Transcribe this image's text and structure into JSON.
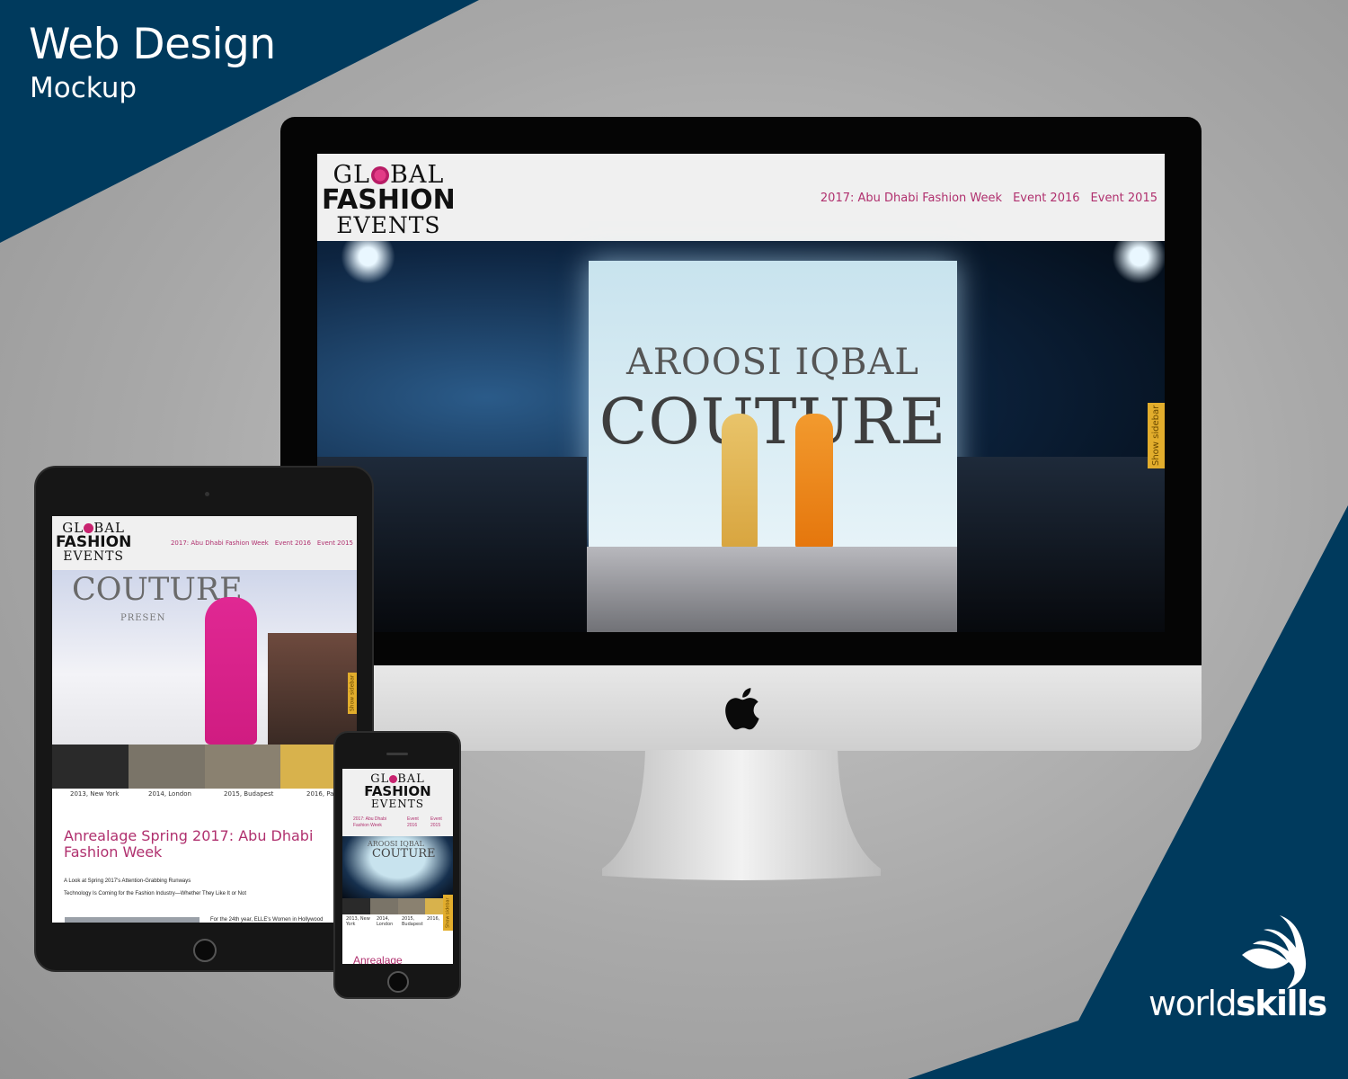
{
  "banner": {
    "title": "Web Design",
    "subtitle": "Mockup"
  },
  "site": {
    "logo": {
      "line1": "GL",
      "line1_end": "BAL",
      "line2": "FASHION",
      "line3": "EVENTS"
    },
    "nav": [
      "2017: Abu Dhabi Fashion Week",
      "Event 2016",
      "Event 2015"
    ],
    "sidebar_tab": "Show sidebar",
    "hero_text": {
      "brand": "AROOSI IQBAL",
      "line": "COUTURE"
    }
  },
  "tablet": {
    "hero_text": {
      "brand": "COUTURE",
      "presents": "PRESEN"
    },
    "thumb_captions": [
      "2013, New York",
      "2014, London",
      "2015, Budapest",
      "2016, Pari"
    ],
    "article_title": "Anrealage Spring 2017: Abu Dhabi Fashion Week",
    "article_lines": [
      "A Look at Spring 2017's Attention-Grabbing Runways",
      "Technology Is Coming for the Fashion Industry—Whether They Like It or Not"
    ],
    "footer_snippet": "For the 24th year, ELLE's Women in Hollywood"
  },
  "phone": {
    "nav": [
      [
        "2017: Abu Dhabi",
        "Fashion Week"
      ],
      [
        "Event",
        "2016"
      ],
      [
        "Event",
        "2015"
      ]
    ],
    "thumb_captions": [
      [
        "2013, New",
        "York"
      ],
      [
        "2014,",
        "London"
      ],
      [
        "2015,",
        "Budapest"
      ],
      [
        "2016,",
        ""
      ]
    ],
    "article_title_partial": "Anrealage"
  },
  "brand_mark": {
    "part1": "world",
    "part2": "skills"
  },
  "colors": {
    "navy": "#003a5d",
    "accent": "#b0306e",
    "sidebar_tab": "#e2ad2c"
  }
}
